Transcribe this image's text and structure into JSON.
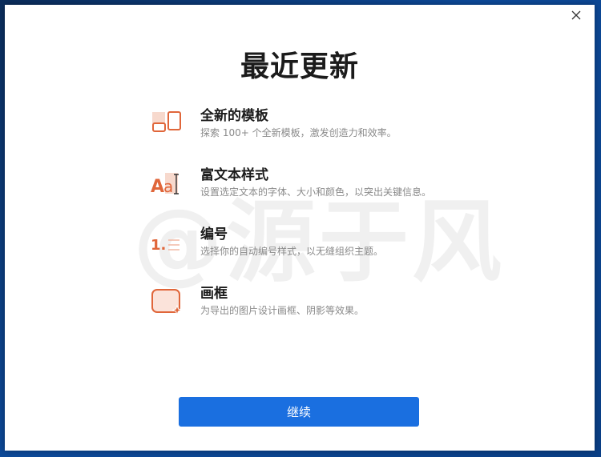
{
  "dialog": {
    "close_icon": "close-icon",
    "title": "最近更新",
    "watermark": "@源于风",
    "continue_label": "继续"
  },
  "features": [
    {
      "icon": "new-templates-icon",
      "title": "全新的模板",
      "desc": "探索 100+ 个全新模板，激发创造力和效率。"
    },
    {
      "icon": "rich-text-styles-icon",
      "title": "富文本样式",
      "desc": "设置选定文本的字体、大小和颜色，以突出关键信息。"
    },
    {
      "icon": "numbering-icon",
      "title": "编号",
      "desc": "选择你的自动编号样式，以无缝组织主题。"
    },
    {
      "icon": "picture-frame-icon",
      "title": "画框",
      "desc": "为导出的图片设计画框、阴影等效果。"
    }
  ],
  "colors": {
    "accent_orange": "#e0663a",
    "button_blue": "#1a6fe0"
  }
}
